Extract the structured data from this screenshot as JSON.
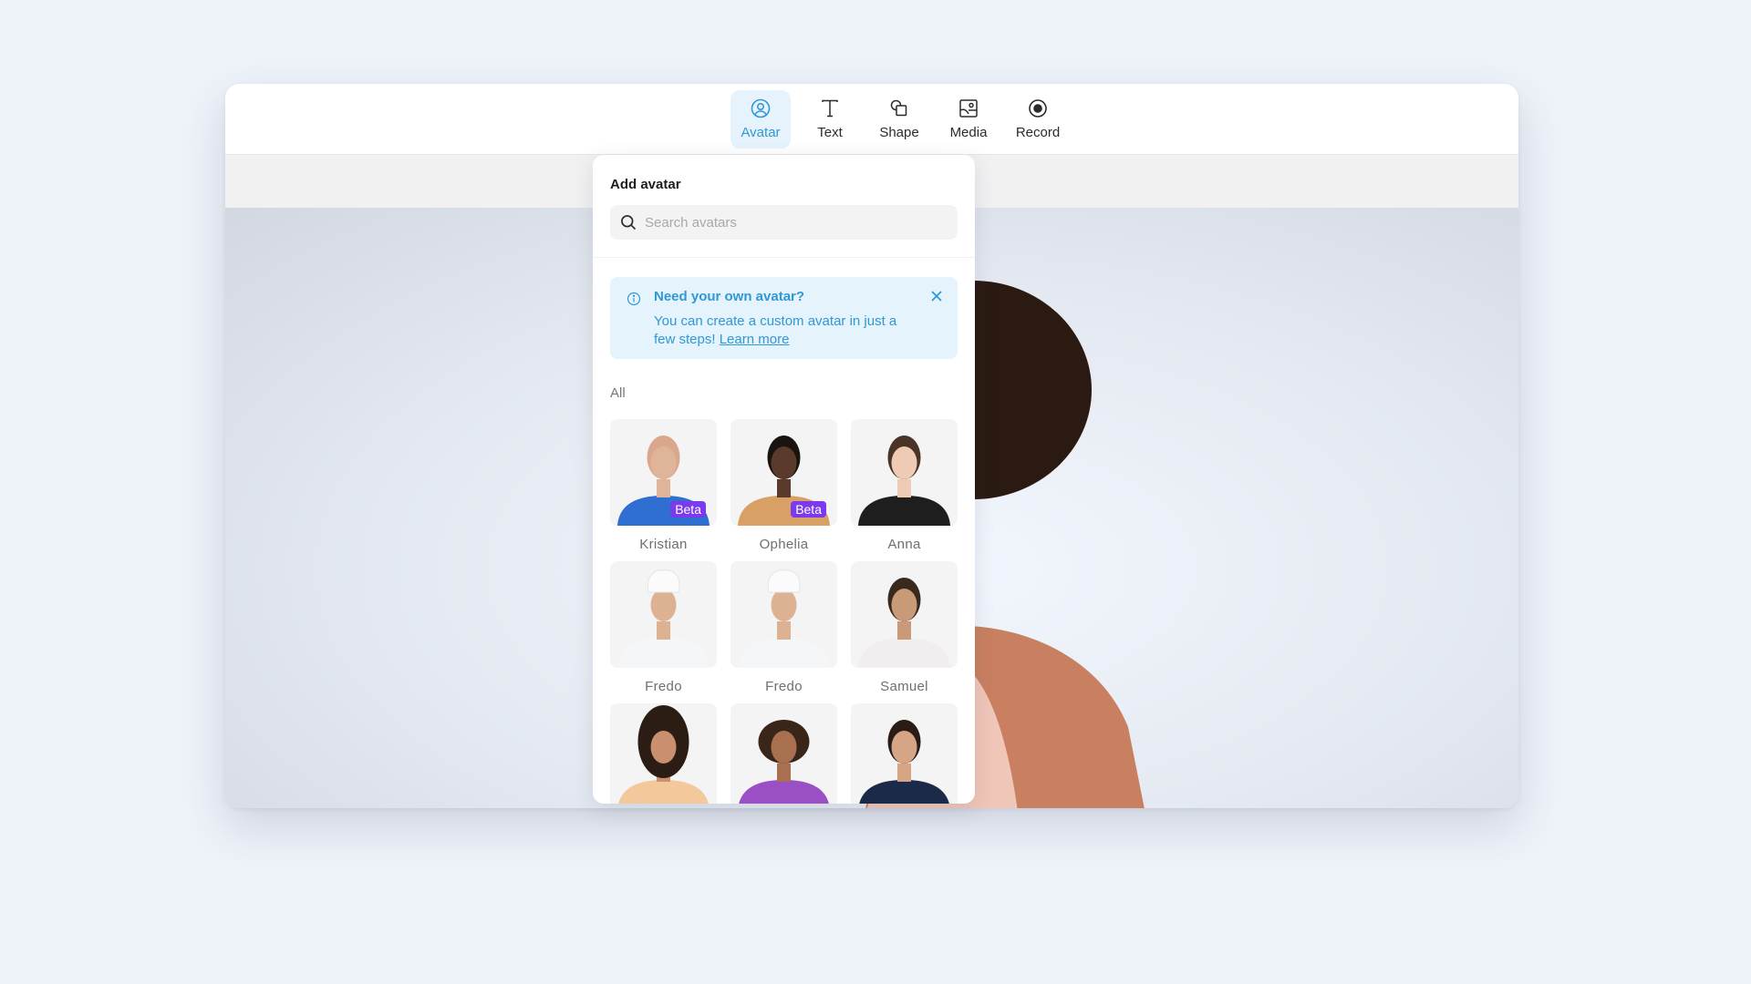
{
  "toolbar": {
    "tools": [
      {
        "label": "Avatar",
        "icon": "avatar-icon",
        "active": true
      },
      {
        "label": "Text",
        "icon": "text-icon",
        "active": false
      },
      {
        "label": "Shape",
        "icon": "shape-icon",
        "active": false
      },
      {
        "label": "Media",
        "icon": "media-icon",
        "active": false
      },
      {
        "label": "Record",
        "icon": "record-icon",
        "active": false
      }
    ]
  },
  "panel": {
    "title": "Add avatar",
    "search": {
      "placeholder": "Search avatars",
      "value": ""
    },
    "info": {
      "title": "Need your own avatar?",
      "body": "You can create a custom avatar in just a few steps!",
      "link": "Learn more"
    },
    "section_label": "All",
    "avatars": [
      {
        "name": "Kristian",
        "badge": "Beta",
        "skin": "#e0b49a",
        "hair": "#d9a88c",
        "shirt": "#2f6fd1"
      },
      {
        "name": "Ophelia",
        "badge": "Beta",
        "skin": "#5a3a2a",
        "hair": "#1a1410",
        "shirt": "#d9a066"
      },
      {
        "name": "Anna",
        "badge": "",
        "skin": "#efcbb5",
        "hair": "#4a3426",
        "shirt": "#1e1e1e"
      },
      {
        "name": "Fredo",
        "badge": "",
        "skin": "#dcb293",
        "hair": "#ffffff",
        "shirt": "#f4f6f8"
      },
      {
        "name": "Fredo",
        "badge": "",
        "skin": "#dcb293",
        "hair": "#ffffff",
        "shirt": "#f4f6f8"
      },
      {
        "name": "Samuel",
        "badge": "",
        "skin": "#c99a78",
        "hair": "#3a2a1e",
        "shirt": "#f2eef0"
      },
      {
        "name": "",
        "badge": "",
        "skin": "#c98f6e",
        "hair": "#2b1d14",
        "shirt": "#f3c89a"
      },
      {
        "name": "",
        "badge": "",
        "skin": "#a8704f",
        "hair": "#3a2618",
        "shirt": "#9b4fc4"
      },
      {
        "name": "",
        "badge": "",
        "skin": "#d6a585",
        "hair": "#2a1c14",
        "shirt": "#1c2a4a"
      }
    ]
  },
  "colors": {
    "accent": "#2f98d6",
    "badge": "#7c3aed",
    "info_bg": "#e4f3fc"
  }
}
